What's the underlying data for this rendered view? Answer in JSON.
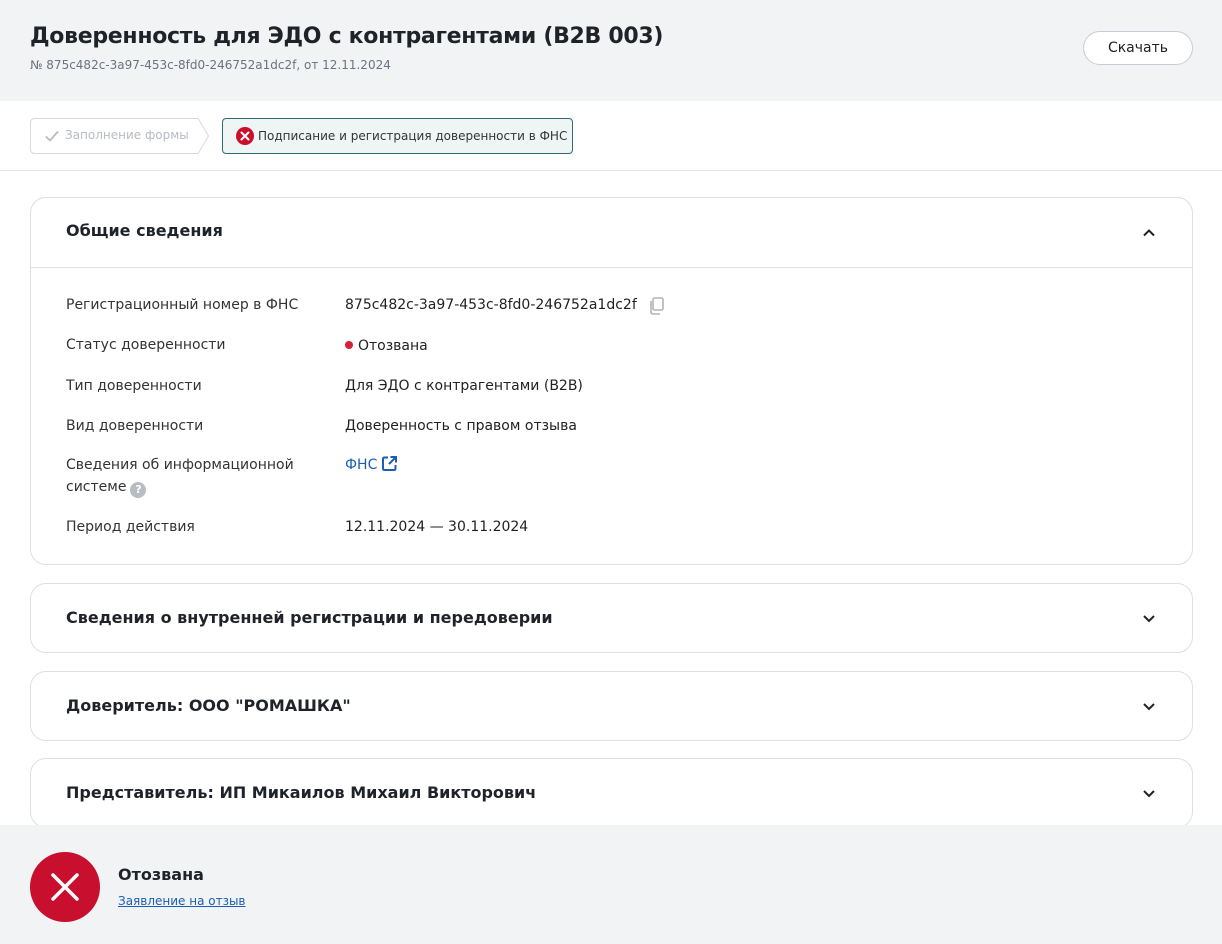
{
  "header": {
    "title": "Доверенность для ЭДО с контрагентами (B2B 003)",
    "subtitle": "№ 875c482c-3a97-453c-8fd0-246752a1dc2f, от 12.11.2024",
    "download_label": "Скачать"
  },
  "steps": [
    {
      "label": "Заполнение формы",
      "state": "done"
    },
    {
      "label": "Подписание и регистрация доверенности в ФНС",
      "state": "error"
    }
  ],
  "general": {
    "heading": "Общие сведения",
    "rows": [
      {
        "label": "Регистрационный номер в ФНС",
        "value": "875c482c-3a97-453c-8fd0-246752a1dc2f"
      },
      {
        "label": "Статус доверенности",
        "value": "Отозвана"
      },
      {
        "label": "Тип доверенности",
        "value": "Для ЭДО с контрагентами (B2B)"
      },
      {
        "label": "Вид доверенности",
        "value": "Доверенность с правом отзыва"
      },
      {
        "label_line1": "Сведения об информационной",
        "label_line2": "системе",
        "value": "ФНС"
      },
      {
        "label": "Период действия",
        "value": "12.11.2024 — 30.11.2024"
      }
    ]
  },
  "sections": [
    {
      "heading": "Сведения о внутренней регистрации и передоверии"
    },
    {
      "heading": "Доверитель: ООО \"РОМАШКА\""
    },
    {
      "heading": "Представитель: ИП Микаилов Михаил Викторович"
    }
  ],
  "footer": {
    "status": "Отозвана",
    "link": "Заявление на отзыв"
  },
  "colors": {
    "accent_link": "#1a5fb4",
    "error_red": "#c8102e",
    "step_active_border": "#2e6b6f",
    "header_bg": "#f2f3f5"
  }
}
